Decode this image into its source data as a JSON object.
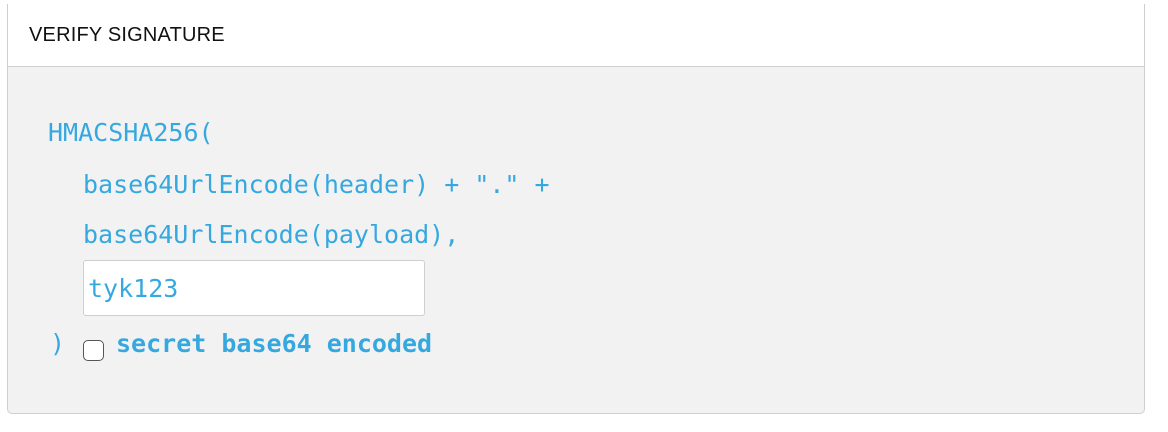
{
  "panel": {
    "title": "VERIFY SIGNATURE"
  },
  "code": {
    "line1": "HMACSHA256(",
    "line2": "base64UrlEncode(header) + \".\" +",
    "line3": "base64UrlEncode(payload),",
    "close": ")"
  },
  "secret": {
    "value": "tyk123",
    "base64_checkbox_label": "secret base64 encoded",
    "base64_checked": false
  },
  "colors": {
    "code": "#36a8e0",
    "panel_bg": "#f2f2f2",
    "header_bg": "#ffffff",
    "border": "#cfcfcf"
  }
}
